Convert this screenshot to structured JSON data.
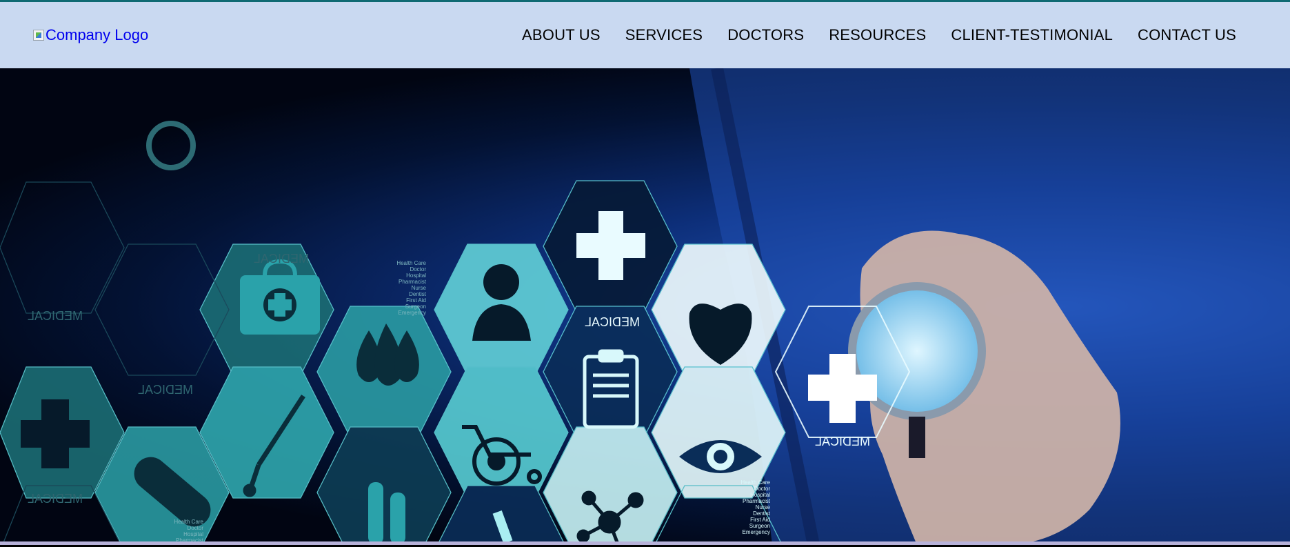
{
  "header": {
    "logo_alt": "Company Logo",
    "nav": [
      {
        "label": "ABOUT US"
      },
      {
        "label": "SERVICES"
      },
      {
        "label": "DOCTORS"
      },
      {
        "label": "RESOURCES"
      },
      {
        "label": "CLIENT-TESTIMONIAL"
      },
      {
        "label": "CONTACT US"
      }
    ]
  },
  "hero": {
    "hex_label": "MEDICAL",
    "hex_list": [
      "Health Care",
      "Doctor",
      "Hospital",
      "Pharmacist",
      "Nurse",
      "Dentist",
      "First Aid",
      "Surgeon",
      "Emergency"
    ]
  },
  "colors": {
    "header_bg": "#c9d9f1",
    "top_border": "#0f6a73",
    "link": "#0000ee",
    "hex_teal": "#3fb6bf",
    "hex_light": "#d8f8fb"
  }
}
